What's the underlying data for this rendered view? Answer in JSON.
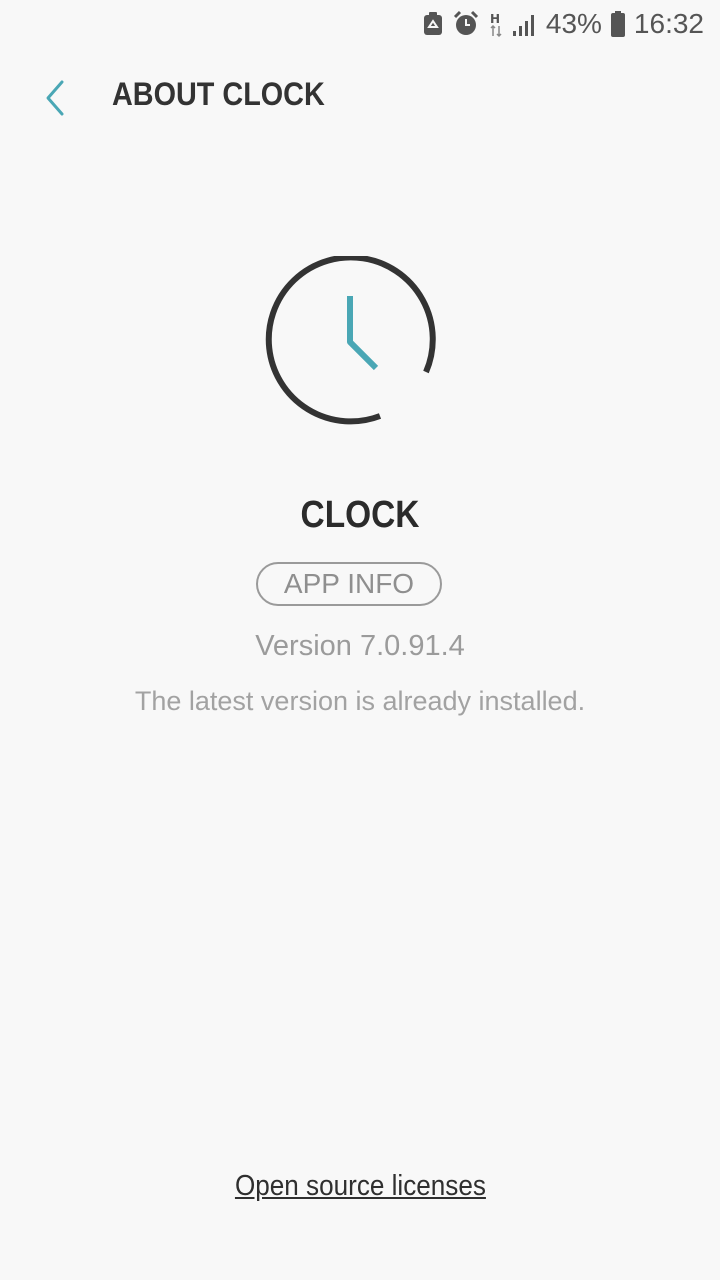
{
  "status_bar": {
    "battery_percent": "43%",
    "time": "16:32",
    "network_type": "H",
    "icons": [
      "recycle-notification-icon",
      "alarm-icon",
      "network-h-icon",
      "signal-icon",
      "battery-icon"
    ]
  },
  "header": {
    "title": "ABOUT CLOCK",
    "back_icon": "chevron-left-icon"
  },
  "app": {
    "name": "CLOCK",
    "icon": "clock-icon",
    "app_info_label": "APP INFO",
    "version": "Version 7.0.91.4",
    "update_status": "The latest version is already installed."
  },
  "footer": {
    "licenses_link": "Open source licenses"
  },
  "colors": {
    "accent": "#4aa7b5",
    "background": "#f8f8f8",
    "title": "#333333",
    "secondary_text": "#9b9b9b"
  }
}
